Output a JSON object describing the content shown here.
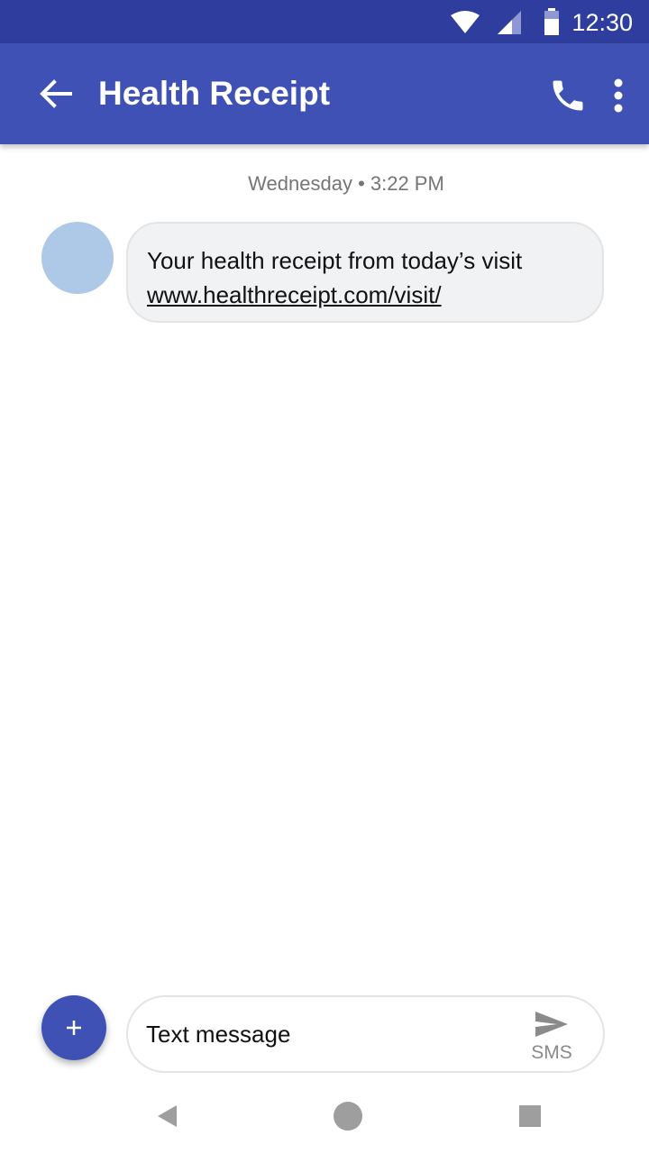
{
  "status_bar": {
    "time": "12:30",
    "icons": [
      "wifi-icon",
      "signal-icon",
      "battery-icon"
    ]
  },
  "app_bar": {
    "title": "Health Receipt",
    "back_icon": "arrow-left-icon",
    "actions": [
      "phone-icon",
      "more-vert-icon"
    ]
  },
  "conversation": {
    "timestamp": "Wednesday • 3:22 PM",
    "messages": [
      {
        "text": "Your health receipt from today’s visit",
        "link": "www.healthreceipt.com/visit/"
      }
    ]
  },
  "composer": {
    "attach_icon": "plus-icon",
    "placeholder": "Text message",
    "send_icon": "send-icon",
    "send_label": "SMS"
  },
  "nav_bar": {
    "icons": [
      "back-triangle-icon",
      "home-circle-icon",
      "recents-square-icon"
    ]
  },
  "colors": {
    "status_bar": "#2f3d9e",
    "app_bar": "#3f51b5",
    "avatar": "#aec8e8",
    "bubble": "#f1f2f4"
  }
}
